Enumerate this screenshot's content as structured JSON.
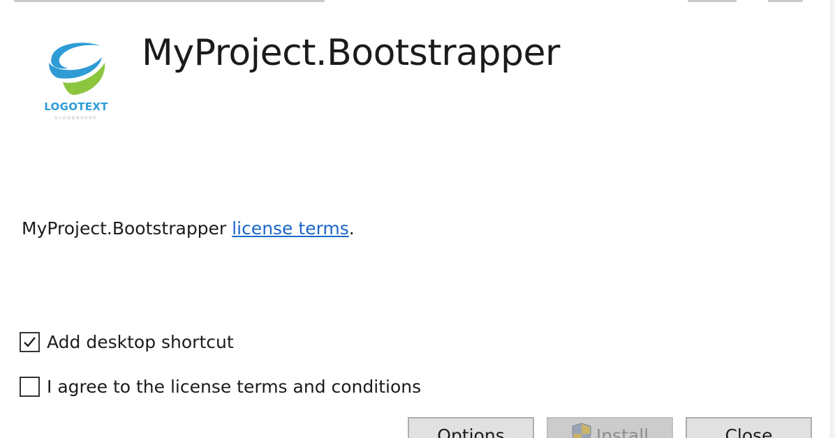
{
  "app": {
    "title": "MyProject.Bootstrapper"
  },
  "logo": {
    "text": "LOGOTEXT",
    "tagline": "SLOGANHERE",
    "colors": {
      "blue": "#2f9cd6",
      "green": "#8cc63f"
    }
  },
  "license": {
    "prefix": "MyProject.Bootstrapper ",
    "link_label": "license terms",
    "suffix": "."
  },
  "options": {
    "desktop_shortcut": {
      "label": "Add desktop shortcut",
      "checked": true
    },
    "agree_license": {
      "label": "I agree to the license terms and conditions",
      "checked": false
    }
  },
  "buttons": {
    "options_label": "Options",
    "install_label": "Install",
    "install_enabled": false,
    "install_icon": "uac-shield-icon",
    "close_label": "Close"
  },
  "colors": {
    "link": "#1a66c9",
    "button_bg": "#e1e1e1",
    "button_disabled_bg": "#cccccc"
  }
}
